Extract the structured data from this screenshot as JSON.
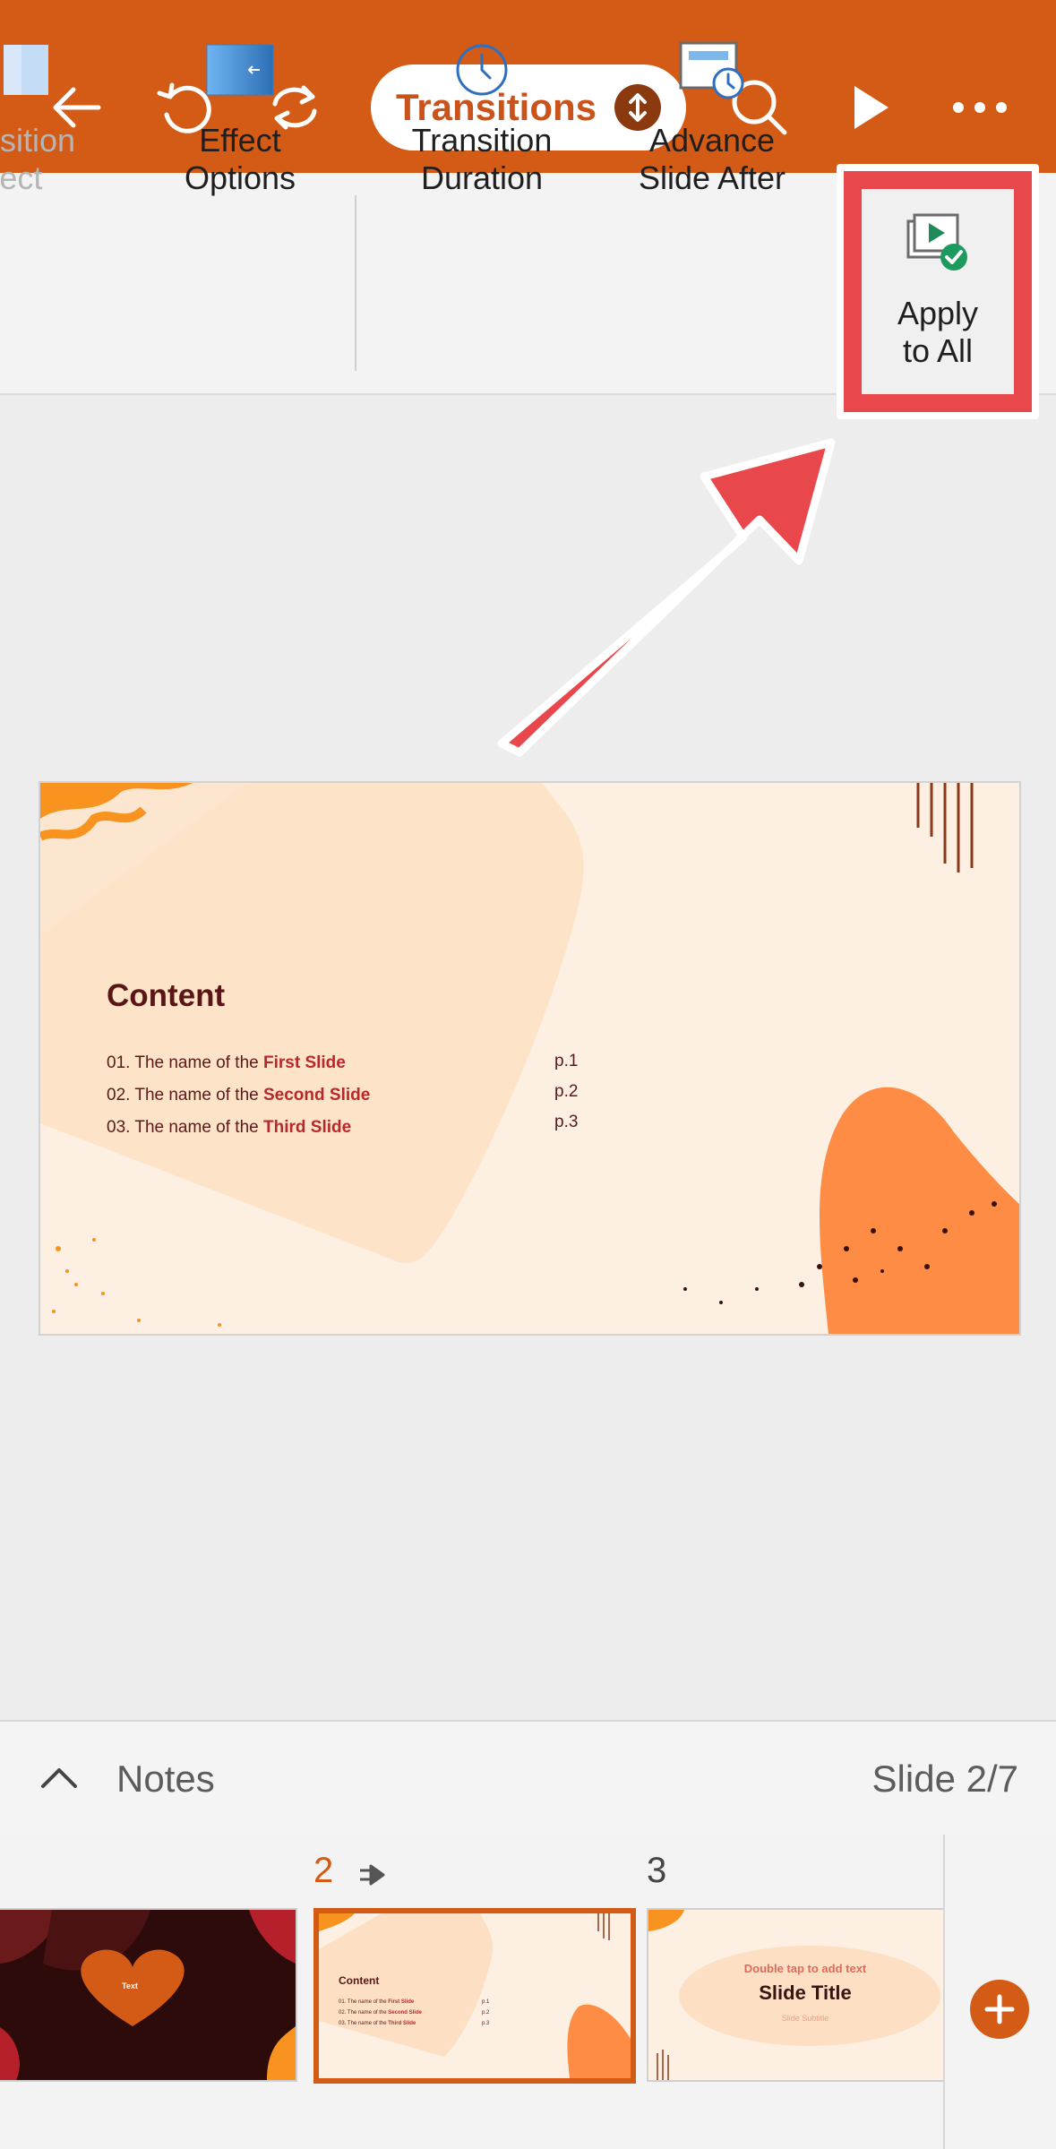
{
  "toolbar": {
    "tab_label": "Transitions",
    "accent_color": "#d35b15"
  },
  "ribbon": {
    "items": [
      {
        "label1": "nsition",
        "label2": "ffect",
        "icon": "transition-effect-icon"
      },
      {
        "label1": "Effect",
        "label2": "Options",
        "icon": "effect-options-icon"
      },
      {
        "label1": "Transition",
        "label2": "Duration",
        "icon": "clock-icon"
      },
      {
        "label1": "Advance",
        "label2": "Slide After",
        "icon": "advance-slide-icon"
      },
      {
        "label1": "Apply",
        "label2": "to All",
        "icon": "apply-to-all-icon"
      }
    ]
  },
  "slide": {
    "title": "Content",
    "rows": [
      {
        "prefix": "01. The name of the ",
        "bold": "First Slide",
        "page": "p.1"
      },
      {
        "prefix": "02. The name of the ",
        "bold": "Second Slide",
        "page": "p.2"
      },
      {
        "prefix": "03. The name of the ",
        "bold": "Third Slide",
        "page": "p.3"
      }
    ]
  },
  "notes": {
    "label": "Notes",
    "slide_count": "Slide 2/7"
  },
  "thumbnails": {
    "slide1_text": "Text",
    "slide2_number": "2",
    "slide2_title": "Content",
    "slide2_rows": [
      {
        "prefix": "01. The name of the ",
        "bold": "First Slide",
        "page": "p.1"
      },
      {
        "prefix": "02. The name of the ",
        "bold": "Second Slide",
        "page": "p.2"
      },
      {
        "prefix": "03. The name of the ",
        "bold": "Third Slide",
        "page": "p.3"
      }
    ],
    "slide3_number": "3",
    "slide3_hint": "Double tap to add text",
    "slide3_title": "Slide Title",
    "slide3_subtitle": "Slide Subtitle"
  }
}
